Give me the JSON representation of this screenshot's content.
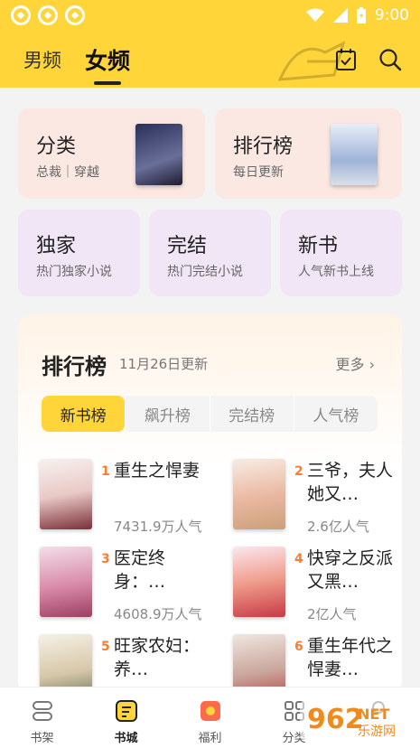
{
  "status": {
    "time": "9:00"
  },
  "header": {
    "tab_male": "男频",
    "tab_female": "女频"
  },
  "quick": {
    "category": {
      "title": "分类",
      "sub": "总裁｜穿越"
    },
    "ranking": {
      "title": "排行榜",
      "sub": "每日更新"
    },
    "exclusive": {
      "title": "独家",
      "sub": "热门独家小说"
    },
    "finished": {
      "title": "完结",
      "sub": "热门完结小说"
    },
    "new": {
      "title": "新书",
      "sub": "人气新书上线"
    }
  },
  "rank": {
    "title": "排行榜",
    "date": "11月26日更新",
    "more": "更多 ›",
    "tabs": [
      "新书榜",
      "飙升榜",
      "完结榜",
      "人气榜"
    ],
    "books": [
      {
        "num": "1",
        "name": "重生之悍妻",
        "pop": "7431.9万人气"
      },
      {
        "num": "2",
        "name": "三爷，夫人她又…",
        "pop": "2.6亿人气"
      },
      {
        "num": "3",
        "name": "医定终身：…",
        "pop": "4608.9万人气"
      },
      {
        "num": "4",
        "name": "快穿之反派又黑…",
        "pop": "2亿人气"
      },
      {
        "num": "5",
        "name": "旺家农妇：养…",
        "pop": ""
      },
      {
        "num": "6",
        "name": "重生年代之悍妻…",
        "pop": ""
      }
    ]
  },
  "nav": {
    "items": [
      "书架",
      "书城",
      "福利",
      "分类",
      ""
    ]
  },
  "watermark": {
    "text": "962",
    "sub": "乐游网",
    "suffix": "NET"
  },
  "colors": {
    "accent": "#ffd53a",
    "rank_num": "#ff7b2e"
  }
}
